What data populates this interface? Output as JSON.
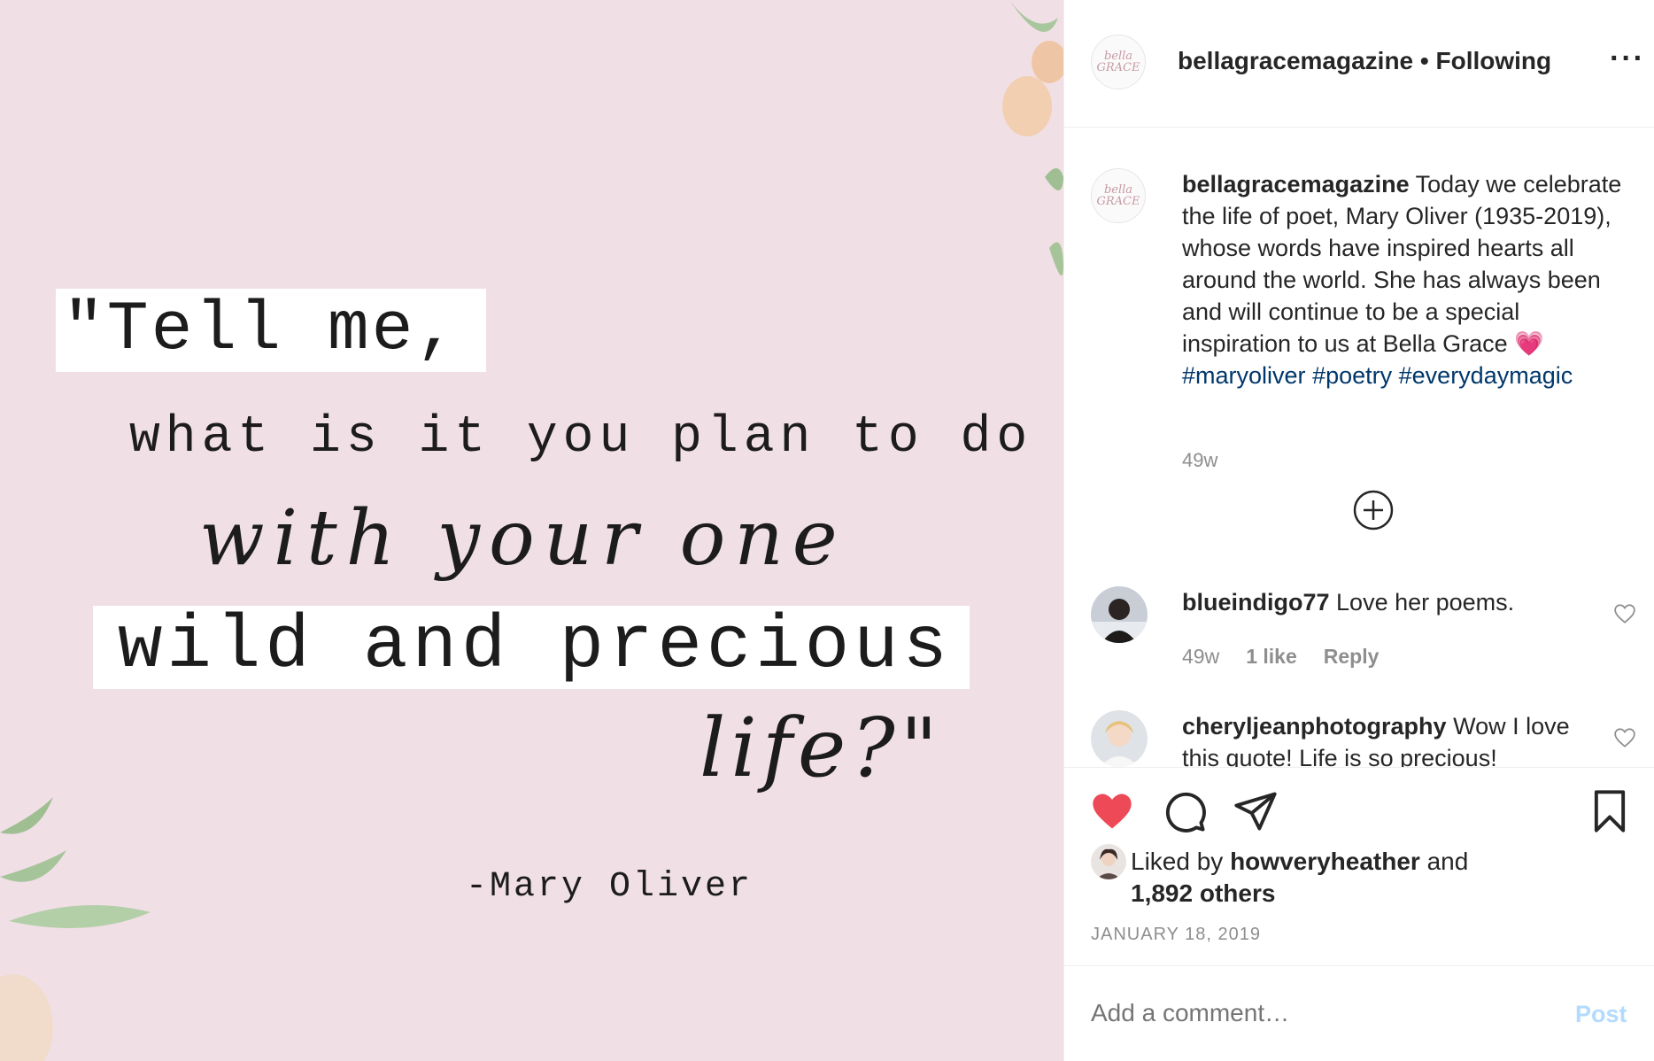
{
  "quote": {
    "line1": "\"Tell me,",
    "line2": "what is it you plan to do",
    "line3": "with your one",
    "line4": "wild and precious",
    "line5": "life?\"",
    "attribution": "-Mary Oliver"
  },
  "header": {
    "avatar_text": "bella GRACE",
    "username": "bellagracemagazine",
    "separator": " • ",
    "follow_status": "Following"
  },
  "caption": {
    "username": "bellagracemagazine",
    "text": "Today we celebrate the life of poet, Mary Oliver (1935-2019), whose words have inspired hearts all around the world. She has always been and will continue to be a special inspiration to us at Bella Grace",
    "emoji": "💗",
    "hashtags": [
      "#maryoliver",
      "#poetry",
      "#everydaymagic"
    ],
    "time": "49w"
  },
  "comments": [
    {
      "username": "blueindigo77",
      "text": "Love her poems.",
      "time": "49w",
      "likes": "1 like",
      "reply": "Reply"
    },
    {
      "username": "cheryljeanphotography",
      "text": "Wow I love this quote! Life is so precious!"
    }
  ],
  "likes": {
    "prefix": "Liked by ",
    "user": "howveryheather",
    "middle": " and",
    "others": "1,892 others"
  },
  "date": "JANUARY 18, 2019",
  "comment_box": {
    "placeholder": "Add a comment…",
    "post_label": "Post"
  },
  "colors": {
    "media_bg": "#f1dfe6",
    "like_red": "#ed4956",
    "hashtag": "#00376b",
    "post_disabled": "#b3dbff"
  },
  "icons": [
    "more-options-icon",
    "add-circle-icon",
    "heart-small-icon",
    "heart-filled-icon",
    "comment-icon",
    "share-icon",
    "bookmark-icon"
  ]
}
